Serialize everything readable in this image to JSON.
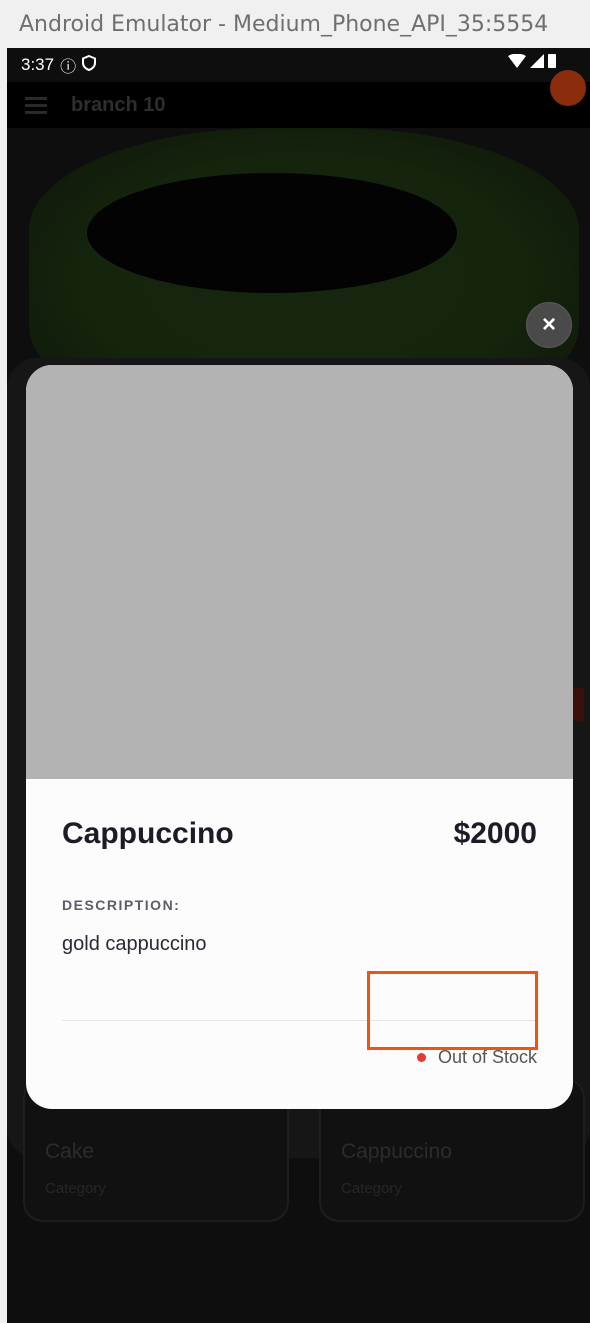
{
  "window": {
    "title": "Android Emulator - Medium_Phone_API_35:5554"
  },
  "status_bar": {
    "time": "3:37"
  },
  "app_bar": {
    "title": "branch 10"
  },
  "background_cards": [
    {
      "name": "Cake",
      "category": "Category"
    },
    {
      "name": "Cappuccino",
      "category": "Category"
    }
  ],
  "modal": {
    "close_symbol": "×",
    "product_name": "Cappuccino",
    "price": "$2000",
    "description_label": "DESCRIPTION:",
    "description": "gold cappuccino",
    "stock_status": "Out of Stock"
  },
  "colors": {
    "accent_highlight": "#f2530f",
    "out_of_stock": "#e53935",
    "image_placeholder": "#b3b3b3"
  },
  "icons": [
    "info-icon",
    "shield-icon",
    "wifi-icon",
    "signal-icon",
    "battery-icon",
    "menu-icon",
    "bell-icon",
    "close-icon"
  ]
}
